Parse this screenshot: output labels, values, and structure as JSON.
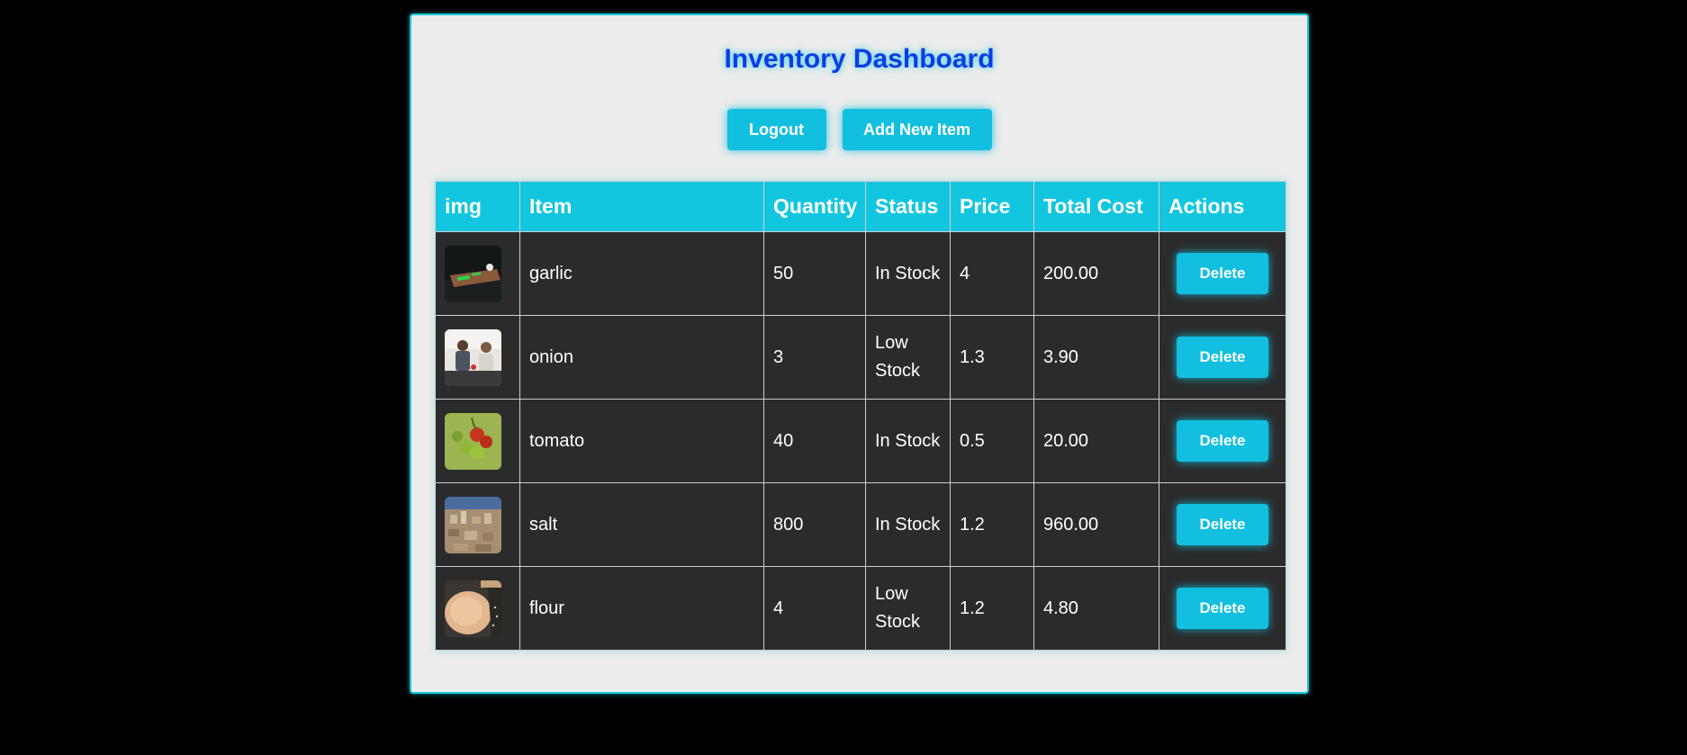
{
  "page": {
    "title": "Inventory Dashboard"
  },
  "toolbar": {
    "logout_label": "Logout",
    "add_label": "Add New Item"
  },
  "table": {
    "headers": [
      "img",
      "Item",
      "Quantity",
      "Status",
      "Price",
      "Total Cost",
      "Actions"
    ],
    "rows": [
      {
        "item": "garlic",
        "quantity": "50",
        "status": "In Stock",
        "price": "4",
        "total": "200.00",
        "action": "Delete",
        "thumb": "dark-kitchen-photo"
      },
      {
        "item": "onion",
        "quantity": "3",
        "status": "Low Stock",
        "price": "1.3",
        "total": "3.90",
        "action": "Delete",
        "thumb": "people-cooking-photo"
      },
      {
        "item": "tomato",
        "quantity": "40",
        "status": "In Stock",
        "price": "0.5",
        "total": "20.00",
        "action": "Delete",
        "thumb": "tomato-vine-photo"
      },
      {
        "item": "salt",
        "quantity": "800",
        "status": "In Stock",
        "price": "1.2",
        "total": "960.00",
        "action": "Delete",
        "thumb": "city-aerial-photo"
      },
      {
        "item": "flour",
        "quantity": "4",
        "status": "Low Stock",
        "price": "1.2",
        "total": "4.80",
        "action": "Delete",
        "thumb": "dough-photo"
      }
    ]
  },
  "colors": {
    "page_background": "#000000",
    "panel_background": "#ececec",
    "accent": "#12c6df",
    "title": "#0a3de6",
    "row_background": "#2b2b2b"
  }
}
